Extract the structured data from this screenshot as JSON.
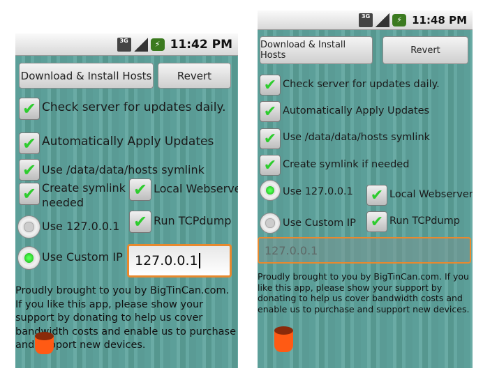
{
  "left": {
    "status": {
      "time": "11:42 PM",
      "network": "3G",
      "icons": [
        "3g-icon",
        "signal-icon",
        "battery-charging-icon"
      ]
    },
    "buttons": {
      "download": "Download & Install Hosts",
      "revert": "Revert"
    },
    "checks": [
      {
        "label": "Check server for updates daily.",
        "checked": true
      },
      {
        "label": "Automatically Apply Updates",
        "checked": true
      },
      {
        "label": "Use /data/data/hosts symlink",
        "checked": true
      },
      {
        "label": "Create symlink if needed",
        "line1": "Create symlink if",
        "line2": "needed",
        "checked": true
      },
      {
        "label": "Local Webserver",
        "checked": true
      },
      {
        "label": "Run TCPdump",
        "checked": true
      }
    ],
    "radios": [
      {
        "label": "Use 127.0.0.1",
        "selected": false
      },
      {
        "label": "Use Custom IP",
        "selected": true
      }
    ],
    "ip_input": {
      "value": "127.0.0.1",
      "enabled": true
    },
    "about": "Proudly brought to you by BigTinCan.com. If you like this app, please show your support by donating to help us cover bandwidth costs and enable us to purchase and support new devices."
  },
  "right": {
    "status": {
      "time": "11:48 PM",
      "network": "3G",
      "icons": [
        "3g-icon",
        "signal-icon",
        "battery-charging-icon"
      ]
    },
    "buttons": {
      "download": "Download & Install Hosts",
      "revert": "Revert"
    },
    "checks": [
      {
        "label": "Check server for updates daily.",
        "checked": true
      },
      {
        "label": "Automatically Apply Updates",
        "checked": true
      },
      {
        "label": "Use /data/data/hosts symlink",
        "checked": true
      },
      {
        "label": "Create symlink if needed",
        "checked": true
      },
      {
        "label": "Local Webserver",
        "checked": true
      },
      {
        "label": "Run TCPdump",
        "checked": true
      }
    ],
    "radios": [
      {
        "label": "Use 127.0.0.1",
        "selected": true
      },
      {
        "label": "Use Custom IP",
        "selected": false
      }
    ],
    "ip_input": {
      "value": "127.0.0.1",
      "enabled": false
    },
    "about": "Proudly brought to you by BigTinCan.com. If you like this app, please show your support by donating to help us cover bandwidth costs and enable us to purchase and support new devices."
  },
  "colors": {
    "background": "#5c9f99",
    "accent_focus": "#e8892e",
    "check": "#2ecc2e"
  }
}
